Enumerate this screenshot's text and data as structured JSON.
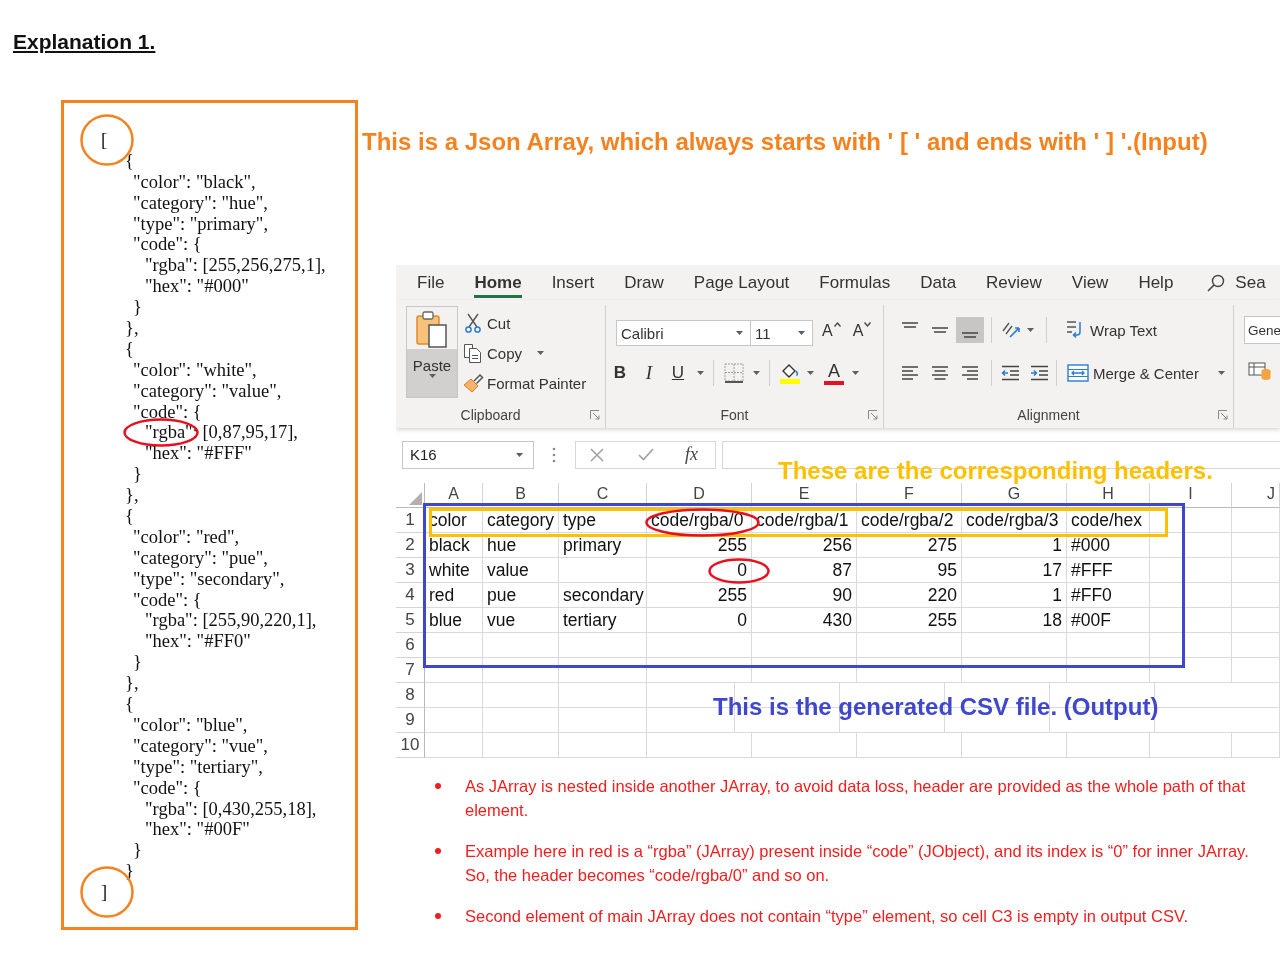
{
  "title": "Explanation 1.",
  "json_input": {
    "caption": "This is a Json Array, which always starts with ' [ ' and ends with ' ] '.(Input)",
    "lines": [
      {
        "text": "[",
        "circled": true,
        "children": [
          {
            "text": "{",
            "circled": false,
            "children": [
              {
                "text": "\"color\": \"black\",",
                "circled": false
              },
              {
                "text": "\"category\": \"hue\",",
                "circled": false
              },
              {
                "text": "\"type\": \"primary\",",
                "circled": false
              },
              {
                "text": "\"code\": {",
                "circled": false,
                "children": [
                  {
                    "text": "\"rgba\": [255,256,275,1],",
                    "circled": false
                  },
                  {
                    "text": "\"hex\": \"#000\"",
                    "circled": false
                  }
                ]
              },
              {
                "text": "}",
                "circled": false
              }
            ]
          },
          {
            "text": "},",
            "circled": false
          },
          {
            "text": "{",
            "circled": false,
            "children": [
              {
                "text": "\"color\": \"white\",",
                "circled": false
              },
              {
                "text": "\"category\": \"value\",",
                "circled": false
              },
              {
                "text": "\"code\": {",
                "circled": false,
                "children": [
                  {
                    "text": "\"rgba\": [0,87,95,17],",
                    "circled": true
                  },
                  {
                    "text": "\"hex\": \"#FFF\"",
                    "circled": false
                  }
                ]
              },
              {
                "text": "}",
                "circled": false
              }
            ]
          },
          {
            "text": "},",
            "circled": false
          },
          {
            "text": "{",
            "circled": false,
            "children": [
              {
                "text": "\"color\": \"red\",",
                "circled": false
              },
              {
                "text": "\"category\": \"pue\",",
                "circled": false
              },
              {
                "text": "\"type\": \"secondary\",",
                "circled": false
              },
              {
                "text": "\"code\": {",
                "circled": false,
                "children": [
                  {
                    "text": "\"rgba\": [255,90,220,1],",
                    "circled": false
                  },
                  {
                    "text": "\"hex\": \"#FF0\"",
                    "circled": false
                  }
                ]
              },
              {
                "text": "}",
                "circled": false
              }
            ]
          },
          {
            "text": "},",
            "circled": false
          },
          {
            "text": "{",
            "circled": false,
            "children": [
              {
                "text": "\"color\": \"blue\",",
                "circled": false
              },
              {
                "text": "\"category\": \"vue\",",
                "circled": false
              },
              {
                "text": "\"type\": \"tertiary\",",
                "circled": false
              },
              {
                "text": "\"code\": {",
                "circled": false,
                "children": [
                  {
                    "text": "\"rgba\": [0,430,255,18],",
                    "circled": false
                  },
                  {
                    "text": "\"hex\": \"#00F\"",
                    "circled": false
                  }
                ]
              },
              {
                "text": "}",
                "circled": false
              }
            ]
          },
          {
            "text": "}",
            "circled": false
          }
        ]
      },
      {
        "text": "]",
        "circled": true
      }
    ]
  },
  "excel": {
    "tabs": [
      {
        "label": "File",
        "selected": false
      },
      {
        "label": "Home",
        "selected": true
      },
      {
        "label": "Insert",
        "selected": false
      },
      {
        "label": "Draw",
        "selected": false
      },
      {
        "label": "Page Layout",
        "selected": false
      },
      {
        "label": "Formulas",
        "selected": false
      },
      {
        "label": "Data",
        "selected": false
      },
      {
        "label": "Review",
        "selected": false
      },
      {
        "label": "View",
        "selected": false
      },
      {
        "label": "Help",
        "selected": false
      }
    ],
    "search": "Sea",
    "clipboard": {
      "paste": "Paste",
      "cut": "Cut",
      "copy": "Copy",
      "format_painter": "Format Painter",
      "label": "Clipboard"
    },
    "font": {
      "name": "Calibri",
      "size": "11",
      "grow": "A",
      "shrink": "A",
      "bold": "B",
      "italic": "I",
      "underline": "U",
      "font_color": "A",
      "label": "Font"
    },
    "alignment": {
      "vertical": [
        {
          "kind": "top",
          "selected": false
        },
        {
          "kind": "middle",
          "selected": false
        },
        {
          "kind": "bottom",
          "selected": true
        }
      ],
      "horizontal": [
        {
          "kind": "left",
          "selected": false
        },
        {
          "kind": "center",
          "selected": false
        },
        {
          "kind": "right",
          "selected": false
        }
      ],
      "wrap_text": "Wrap Text",
      "merge": "Merge & Center",
      "label": "Alignment"
    },
    "number": {
      "format": "Gene"
    },
    "name_box": "K16",
    "function_label": "fx",
    "headers_note": "These are the corresponding headers.",
    "columns": [
      "A",
      "B",
      "C",
      "D",
      "E",
      "F",
      "G",
      "H",
      "I",
      "J"
    ],
    "rows": [
      {
        "number": "1",
        "cells": [
          {
            "text": "color",
            "kind": "text",
            "circled": false
          },
          {
            "text": "category",
            "kind": "text",
            "circled": false
          },
          {
            "text": "type",
            "kind": "text",
            "circled": false
          },
          {
            "text": "code/rgba/0",
            "kind": "text",
            "circled": true
          },
          {
            "text": "code/rgba/1",
            "kind": "text",
            "circled": false
          },
          {
            "text": "code/rgba/2",
            "kind": "text",
            "circled": false
          },
          {
            "text": "code/rgba/3",
            "kind": "text",
            "circled": false
          },
          {
            "text": "code/hex",
            "kind": "text",
            "circled": false
          }
        ]
      },
      {
        "number": "2",
        "cells": [
          {
            "text": "black",
            "kind": "text",
            "circled": false
          },
          {
            "text": "hue",
            "kind": "text",
            "circled": false
          },
          {
            "text": "primary",
            "kind": "text",
            "circled": false
          },
          {
            "text": "255",
            "kind": "number",
            "circled": false
          },
          {
            "text": "256",
            "kind": "number",
            "circled": false
          },
          {
            "text": "275",
            "kind": "number",
            "circled": false
          },
          {
            "text": "1",
            "kind": "number",
            "circled": false
          },
          {
            "text": "#000",
            "kind": "text",
            "circled": false
          }
        ]
      },
      {
        "number": "3",
        "cells": [
          {
            "text": "white",
            "kind": "text",
            "circled": false
          },
          {
            "text": "value",
            "kind": "text",
            "circled": false
          },
          {
            "kind": "text",
            "circled": false
          },
          {
            "text": "0",
            "kind": "number",
            "circled": true
          },
          {
            "text": "87",
            "kind": "number",
            "circled": false
          },
          {
            "text": "95",
            "kind": "number",
            "circled": false
          },
          {
            "text": "17",
            "kind": "number",
            "circled": false
          },
          {
            "text": "#FFF",
            "kind": "text",
            "circled": false
          }
        ]
      },
      {
        "number": "4",
        "cells": [
          {
            "text": "red",
            "kind": "text",
            "circled": false
          },
          {
            "text": "pue",
            "kind": "text",
            "circled": false
          },
          {
            "text": "secondary",
            "kind": "text",
            "circled": false
          },
          {
            "text": "255",
            "kind": "number",
            "circled": false
          },
          {
            "text": "90",
            "kind": "number",
            "circled": false
          },
          {
            "text": "220",
            "kind": "number",
            "circled": false
          },
          {
            "text": "1",
            "kind": "number",
            "circled": false
          },
          {
            "text": "#FF0",
            "kind": "text",
            "circled": false
          }
        ]
      },
      {
        "number": "5",
        "cells": [
          {
            "text": "blue",
            "kind": "text",
            "circled": false
          },
          {
            "text": "vue",
            "kind": "text",
            "circled": false
          },
          {
            "text": "tertiary",
            "kind": "text",
            "circled": false
          },
          {
            "text": "0",
            "kind": "number",
            "circled": false
          },
          {
            "text": "430",
            "kind": "number",
            "circled": false
          },
          {
            "text": "255",
            "kind": "number",
            "circled": false
          },
          {
            "text": "18",
            "kind": "number",
            "circled": false
          },
          {
            "text": "#00F",
            "kind": "text",
            "circled": false
          }
        ]
      },
      {
        "number": "6"
      },
      {
        "number": "7"
      },
      {
        "number": "8"
      },
      {
        "number": "9"
      },
      {
        "number": "10"
      }
    ],
    "output_note": "This is the generated CSV file. (Output)"
  },
  "notes": [
    "As JArray is nested inside another JArray, to avoid data loss, header are provided as the whole path of that element.",
    "Example here in red is a “rgba” (JArray) present inside “code” (JObject), and its index is “0” for inner JArray. So, the header becomes “code/rgba/0” and so on.",
    "Second element of main JArray does not contain “type” element, so cell C3 is empty in output CSV."
  ]
}
